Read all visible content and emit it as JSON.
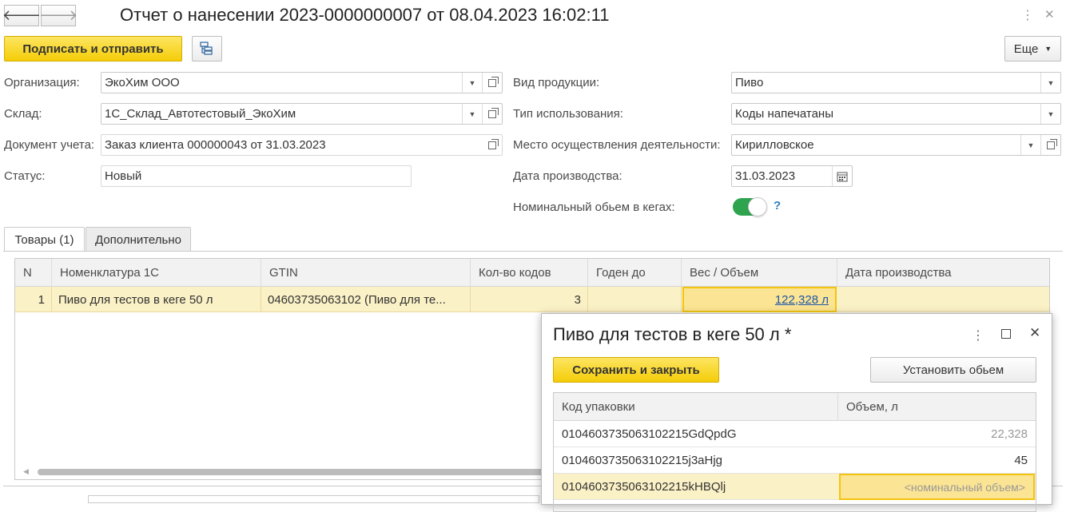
{
  "window": {
    "title": "Отчет о нанесении 2023-0000000007 от 08.04.2023 16:02:11"
  },
  "toolbar": {
    "sign_send_label": "Подписать и отправить",
    "more_label": "Еще"
  },
  "form": {
    "organization": {
      "label": "Организация:",
      "value": "ЭкоХим ООО"
    },
    "warehouse": {
      "label": "Склад:",
      "value": "1С_Склад_Автотестовый_ЭкоХим"
    },
    "accounting_doc": {
      "label": "Документ учета:",
      "value": "Заказ клиента 000000043 от 31.03.2023"
    },
    "status": {
      "label": "Статус:",
      "value": "Новый"
    },
    "product_type": {
      "label": "Вид продукции:",
      "value": "Пиво"
    },
    "usage_type": {
      "label": "Тип использования:",
      "value": "Коды напечатаны"
    },
    "activity_place": {
      "label": "Место осуществления деятельности:",
      "value": "Кирилловское"
    },
    "production_date": {
      "label": "Дата производства:",
      "value": "31.03.2023"
    },
    "nominal_volume": {
      "label": "Номинальный обьем в кегах:",
      "enabled": true,
      "help": "?"
    }
  },
  "tabs": [
    {
      "label": "Товары (1)",
      "active": true
    },
    {
      "label": "Дополнительно",
      "active": false
    }
  ],
  "table": {
    "headers": [
      "N",
      "Номенклатура 1С",
      "GTIN",
      "Кол-во кодов",
      "Годен до",
      "Вес / Объем",
      "Дата производства"
    ],
    "rows": [
      {
        "n": "1",
        "nomenclature": "Пиво для тестов в кеге 50 л",
        "gtin": "04603735063102 (Пиво для те...",
        "codes_count": "3",
        "expires": "",
        "weight_volume": "122,328 л",
        "production_date": ""
      }
    ]
  },
  "modal": {
    "title": "Пиво для тестов в кеге 50 л *",
    "save_close_label": "Сохранить и закрыть",
    "set_volume_label": "Установить обьем",
    "headers": [
      "Код упаковки",
      "Объем, л"
    ],
    "rows": [
      {
        "code": "0104603735063102215GdQpdG",
        "volume": "22,328"
      },
      {
        "code": "0104603735063102215j3aHjg",
        "volume": "45"
      },
      {
        "code": "0104603735063102215kHBQlj",
        "volume": "<номинальный объем>"
      }
    ]
  }
}
